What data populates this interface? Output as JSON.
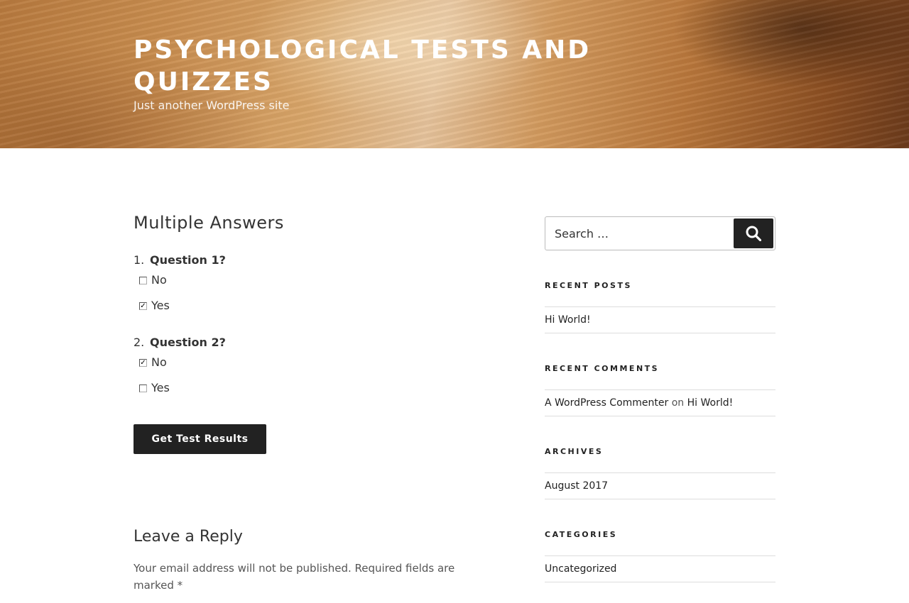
{
  "header": {
    "site_title": "Psychological Tests and Quizzes",
    "site_description": "Just another WordPress site"
  },
  "quiz": {
    "title": "Multiple Answers",
    "questions": [
      {
        "number": "1.",
        "text": "Question 1?",
        "options": [
          {
            "label": "No",
            "checked": false
          },
          {
            "label": "Yes",
            "checked": true
          }
        ]
      },
      {
        "number": "2.",
        "text": "Question 2?",
        "options": [
          {
            "label": "No",
            "checked": true
          },
          {
            "label": "Yes",
            "checked": false
          }
        ]
      }
    ],
    "submit_label": "Get Test Results"
  },
  "reply": {
    "title": "Leave a Reply",
    "note": "Your email address will not be published. Required fields are marked *"
  },
  "sidebar": {
    "search": {
      "placeholder": "Search …"
    },
    "recent_posts": {
      "title": "RECENT POSTS",
      "items": [
        "Hi World!"
      ]
    },
    "recent_comments": {
      "title": "RECENT COMMENTS",
      "author": "A WordPress Commenter",
      "on_word": "on",
      "post": "Hi World!"
    },
    "archives": {
      "title": "ARCHIVES",
      "items": [
        "August 2017"
      ]
    },
    "categories": {
      "title": "CATEGORIES",
      "items": [
        "Uncategorized"
      ]
    }
  },
  "colors": {
    "button_bg": "#222222",
    "text": "#333333",
    "divider": "#dddddd"
  }
}
